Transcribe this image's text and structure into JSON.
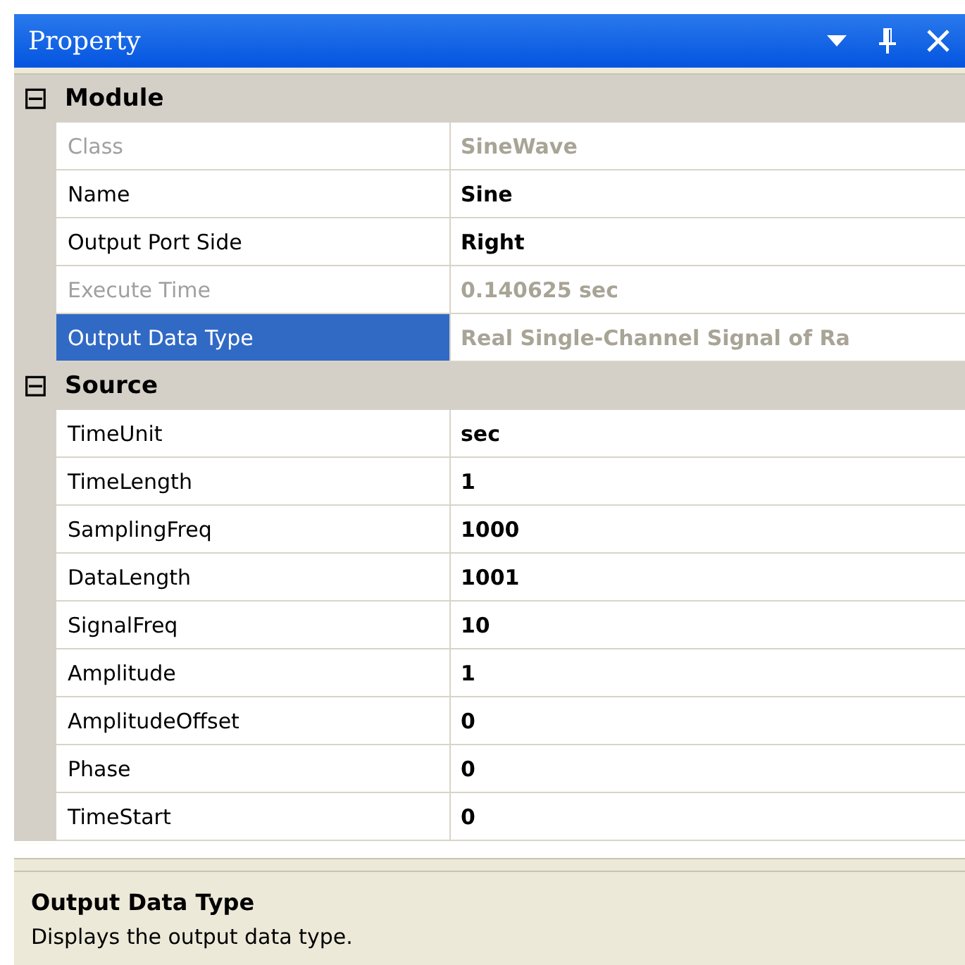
{
  "window": {
    "title": "Property"
  },
  "title_buttons": [
    {
      "kind": "dropdown"
    },
    {
      "kind": "pin"
    },
    {
      "kind": "close"
    }
  ],
  "categories": [
    {
      "name": "Module",
      "expanded": true,
      "expander": "⊟",
      "properties": [
        {
          "name": "Class",
          "value": "SineWave",
          "disabled": true,
          "selected": false
        },
        {
          "name": "Name",
          "value": "Sine",
          "disabled": false,
          "selected": false
        },
        {
          "name": "Output Port Side",
          "value": "Right",
          "disabled": false,
          "selected": false
        },
        {
          "name": "Execute Time",
          "value": "0.140625 sec",
          "disabled": true,
          "selected": false
        },
        {
          "name": "Output Data Type",
          "value": "Real Single-Channel Signal of Ra",
          "disabled": true,
          "selected": true
        }
      ]
    },
    {
      "name": "Source",
      "expanded": true,
      "expander": "⊟",
      "properties": [
        {
          "name": "TimeUnit",
          "value": "sec",
          "disabled": false,
          "selected": false
        },
        {
          "name": "TimeLength",
          "value": "1",
          "disabled": false,
          "selected": false
        },
        {
          "name": "SamplingFreq",
          "value": "1000",
          "disabled": false,
          "selected": false
        },
        {
          "name": "DataLength",
          "value": "1001",
          "disabled": false,
          "selected": false
        },
        {
          "name": "SignalFreq",
          "value": "10",
          "disabled": false,
          "selected": false
        },
        {
          "name": "Amplitude",
          "value": "1",
          "disabled": false,
          "selected": false
        },
        {
          "name": "AmplitudeOffset",
          "value": "0",
          "disabled": false,
          "selected": false
        },
        {
          "name": "Phase",
          "value": "0",
          "disabled": false,
          "selected": false
        },
        {
          "name": "TimeStart",
          "value": "0",
          "disabled": false,
          "selected": false
        }
      ]
    }
  ],
  "description": {
    "title": "Output Data Type",
    "text": "Displays the output data type."
  }
}
